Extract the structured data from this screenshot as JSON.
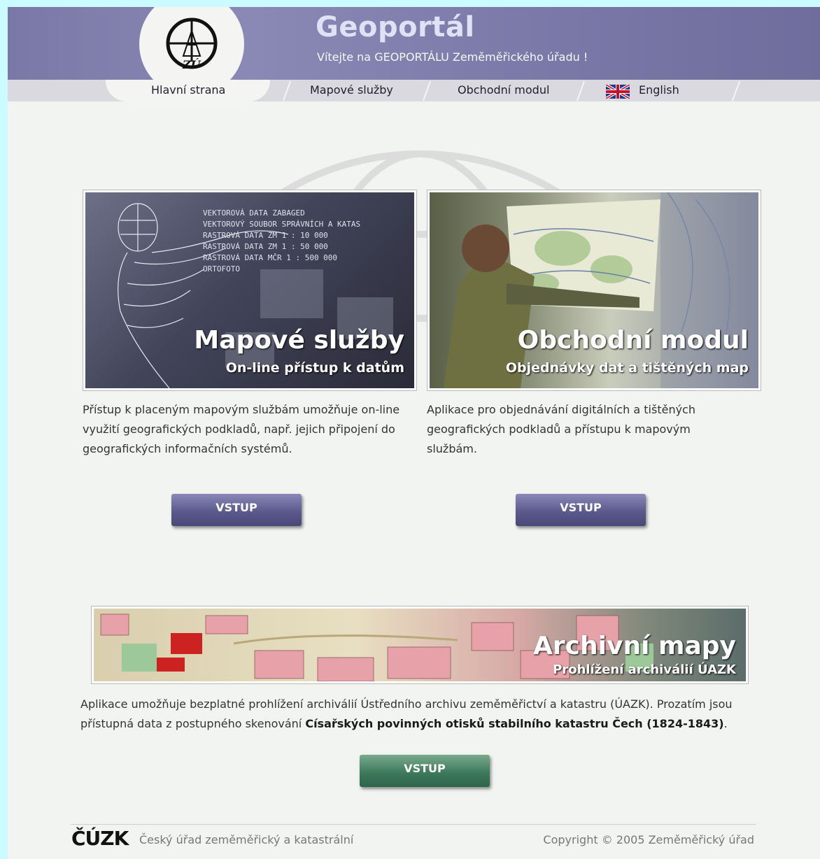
{
  "header": {
    "title": "Geoportál",
    "welcome": "Vítejte na GEOPORTÁLU Zeměměřického úřadu !"
  },
  "nav": {
    "items": [
      {
        "label": "Hlavní strana"
      },
      {
        "label": "Mapové služby"
      },
      {
        "label": "Obchodní modul"
      },
      {
        "label": "English"
      }
    ]
  },
  "cards": [
    {
      "title": "Mapové služby",
      "subtitle": "On-line přístup k datům",
      "overlay_lines": [
        "VEKTOROVÁ DATA ZABAGED",
        "VEKTOROVÝ SOUBOR SPRÁVNÍCH A KATAS",
        "RASTROVÁ DATA ZM 1 : 10 000",
        "RASTROVÁ DATA ZM 1 : 50 000",
        "RASTROVÁ DATA MČR 1 : 500 000",
        "ORTOFOTO"
      ],
      "description": "Přístup k placeným mapovým službám umožňuje on-line využití geografických podkladů, např. jejich připojení do geografických informačních systémů.",
      "button": "VSTUP"
    },
    {
      "title": "Obchodní modul",
      "subtitle": "Objednávky dat a tištěných map",
      "description": "Aplikace pro objednávání digitálních a tištěných geografických podkladů a přístupu k mapovým službám.",
      "button": "VSTUP"
    }
  ],
  "archive": {
    "title": "Archivní mapy",
    "subtitle": "Prohlížení archiválií ÚAZK",
    "description_start": "Aplikace umožňuje bezplatné prohlížení archiválií Ústředního archivu zeměměřictví a katastru (ÚAZK). Prozatím jsou přístupná data z postupného skenování ",
    "description_bold": "Císařských povinných otisků stabilního katastru Čech (1824-1843)",
    "description_end": ".",
    "button": "VSTUP"
  },
  "footer": {
    "logo": "ČÚZK",
    "org": "Český úřad zeměměřický a katastrální",
    "copyright": "Copyright © 2005 Zeměměřický úřad"
  },
  "colors": {
    "header": "#7a78a6",
    "button_blue": "#5c5a8c",
    "button_green": "#3e7a5c"
  }
}
